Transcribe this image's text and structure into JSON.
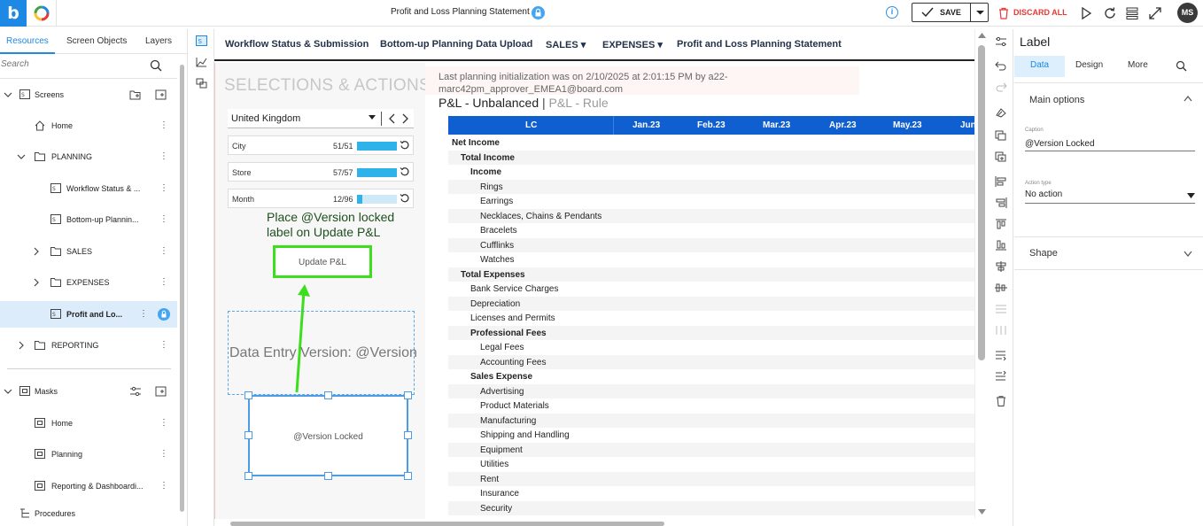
{
  "app": {
    "title": "Profit and Loss Planning Statement",
    "info_glyph": "i",
    "save_label": "SAVE",
    "discard_label": "DISCARD ALL",
    "user_initials": "MS",
    "logo_letter": "b"
  },
  "left_panel": {
    "tabs": [
      "Resources",
      "Screen Objects",
      "Layers"
    ],
    "active_tab": "Resources",
    "search_placeholder": "Search",
    "tree": [
      {
        "label": "Screens",
        "kind": "section"
      },
      {
        "label": "Home",
        "kind": "page"
      },
      {
        "label": "PLANNING",
        "kind": "folder"
      },
      {
        "label": "Workflow Status & ...",
        "kind": "screen"
      },
      {
        "label": "Bottom-up Plannin...",
        "kind": "screen"
      },
      {
        "label": "SALES",
        "kind": "folder"
      },
      {
        "label": "EXPENSES",
        "kind": "folder"
      },
      {
        "label": "Profit and Lo...",
        "kind": "screen",
        "selected": true
      },
      {
        "label": "REPORTING",
        "kind": "folder"
      },
      {
        "label": "Masks",
        "kind": "section"
      },
      {
        "label": "Home",
        "kind": "mask"
      },
      {
        "label": "Planning",
        "kind": "mask"
      },
      {
        "label": "Reporting & Dashboardi...",
        "kind": "mask"
      },
      {
        "label": "Procedures",
        "kind": "section"
      }
    ]
  },
  "navbar": {
    "items": [
      {
        "label": "Workflow Status & Submission"
      },
      {
        "label": "Bottom-up Planning Data Upload"
      },
      {
        "label": "SALES ▾"
      },
      {
        "label": "EXPENSES ▾"
      },
      {
        "label": "Profit and Loss Planning Statement"
      }
    ]
  },
  "canvas": {
    "selections_title": "SELECTIONS & ACTIONS",
    "country": "United Kingdom",
    "filters": [
      {
        "name": "City",
        "count": "51/51",
        "fill": 1.0
      },
      {
        "name": "Store",
        "count": "57/57",
        "fill": 1.0
      },
      {
        "name": "Month",
        "count": "12/96",
        "fill": 0.125
      }
    ],
    "annotation_line1": "Place @Version locked",
    "annotation_line2": "label on Update P&L",
    "update_button": "Update P&L",
    "data_entry_label": "Data Entry Version: @Version",
    "locked_label": "@Version Locked",
    "init_line1": "Last planning initialization was on 2/10/2025 at 2:01:15 PM by a22-",
    "init_line2": "marc42pm_approver_EMEA1@board.com",
    "pl_title_a": "P&L - Unbalanced",
    "pl_title_sep": "|",
    "pl_title_b": "P&L - Rule",
    "grid_headers": [
      "LC",
      "Jan.23",
      "Feb.23",
      "Mar.23",
      "Apr.23",
      "May.23",
      "Jun"
    ],
    "rows": [
      {
        "label": "Net Income",
        "level": 0,
        "bold": true
      },
      {
        "label": "Total Income",
        "level": 1,
        "bold": true
      },
      {
        "label": "Income",
        "level": 2,
        "bold": true
      },
      {
        "label": "Rings",
        "level": 3,
        "bold": false
      },
      {
        "label": "Earrings",
        "level": 3,
        "bold": false
      },
      {
        "label": "Necklaces, Chains & Pendants",
        "level": 3,
        "bold": false
      },
      {
        "label": "Bracelets",
        "level": 3,
        "bold": false
      },
      {
        "label": "Cufflinks",
        "level": 3,
        "bold": false
      },
      {
        "label": "Watches",
        "level": 3,
        "bold": false
      },
      {
        "label": "Total Expenses",
        "level": 1,
        "bold": true
      },
      {
        "label": "Bank Service Charges",
        "level": 2,
        "bold": false
      },
      {
        "label": "Depreciation",
        "level": 2,
        "bold": false
      },
      {
        "label": "Licenses and Permits",
        "level": 2,
        "bold": false
      },
      {
        "label": "Professional Fees",
        "level": 2,
        "bold": true
      },
      {
        "label": "Legal Fees",
        "level": 3,
        "bold": false
      },
      {
        "label": "Accounting Fees",
        "level": 3,
        "bold": false
      },
      {
        "label": "Sales Expense",
        "level": 2,
        "bold": true
      },
      {
        "label": "Advertising",
        "level": 3,
        "bold": false
      },
      {
        "label": "Product Materials",
        "level": 3,
        "bold": false
      },
      {
        "label": "Manufacturing",
        "level": 3,
        "bold": false
      },
      {
        "label": "Shipping and Handling",
        "level": 3,
        "bold": false
      },
      {
        "label": "Equipment",
        "level": 3,
        "bold": false
      },
      {
        "label": "Utilities",
        "level": 3,
        "bold": false
      },
      {
        "label": "Rent",
        "level": 3,
        "bold": false
      },
      {
        "label": "Insurance",
        "level": 3,
        "bold": false
      },
      {
        "label": "Security",
        "level": 3,
        "bold": false
      }
    ]
  },
  "properties": {
    "title": "Label",
    "tabs": [
      "Data",
      "Design",
      "More"
    ],
    "active_tab": "Data",
    "main_options": "Main options",
    "caption_label": "Caption",
    "caption_value": "@Version Locked",
    "action_label": "Action type",
    "action_value": "No action",
    "shape_section": "Shape"
  },
  "colors": {
    "accent": "#1e88e5",
    "grid_header": "#0f5fd0",
    "annotation_green": "#3dde1e",
    "discard_red": "#e53935"
  }
}
